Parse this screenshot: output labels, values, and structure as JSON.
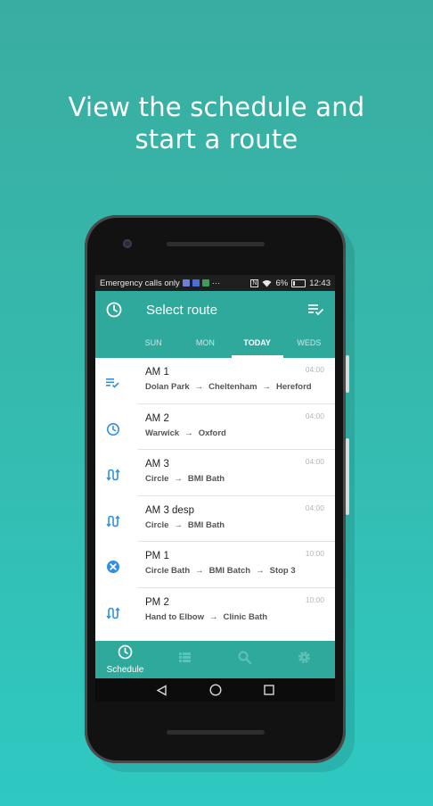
{
  "headline": {
    "line1": "View the schedule and",
    "line2": "start a route"
  },
  "status_bar": {
    "carrier_text": "Emergency calls only",
    "battery": "6%",
    "time": "12:43"
  },
  "app_bar": {
    "title": "Select route"
  },
  "tabs": [
    {
      "label": "SUN",
      "active": false
    },
    {
      "label": "MON",
      "active": false
    },
    {
      "label": "TODAY",
      "active": true
    },
    {
      "label": "WEDS",
      "active": false
    }
  ],
  "routes": [
    {
      "name": "AM 1",
      "stops": [
        "Dolan Park",
        "Cheltenham",
        "Hereford"
      ],
      "time": "04:00",
      "icon": "checklist-icon"
    },
    {
      "name": "AM 2",
      "stops": [
        "Warwick",
        "Oxford"
      ],
      "time": "04:00",
      "icon": "clock-icon"
    },
    {
      "name": "AM 3",
      "stops": [
        "Circle",
        "BMI Bath"
      ],
      "time": "04:00",
      "icon": "route-icon"
    },
    {
      "name": "AM 3 desp",
      "stops": [
        "Circle",
        "BMI Bath"
      ],
      "time": "04:00",
      "icon": "route-icon"
    },
    {
      "name": "PM 1",
      "stops": [
        "Circle Bath",
        "BMI Batch",
        "Stop 3"
      ],
      "time": "10:00",
      "icon": "cancel-icon"
    },
    {
      "name": "PM 2",
      "stops": [
        "Hand to Elbow",
        "Clinic Bath"
      ],
      "time": "10:00",
      "icon": "route-icon"
    }
  ],
  "bottom_nav": [
    {
      "label": "Schedule",
      "icon": "clock-icon",
      "active": true
    },
    {
      "label": "",
      "icon": "list-icon",
      "active": false
    },
    {
      "label": "",
      "icon": "search-icon",
      "active": false
    },
    {
      "label": "",
      "icon": "gear-icon",
      "active": false
    }
  ],
  "colors": {
    "accent": "#2fa99b",
    "icon_blue": "#2f8fe3",
    "background": "#36b9ad"
  }
}
